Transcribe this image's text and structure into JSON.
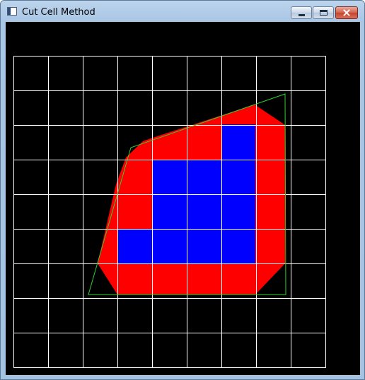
{
  "window": {
    "title": "Cut Cell Method",
    "controls": [
      "minimize",
      "maximize",
      "close"
    ]
  },
  "canvas": {
    "background": "#000000",
    "grid_color": "#ffffff",
    "boundary_color": "#33cc33",
    "cut_cell_color": "#ff0000",
    "interior_cell_color": "#0000ff"
  }
}
